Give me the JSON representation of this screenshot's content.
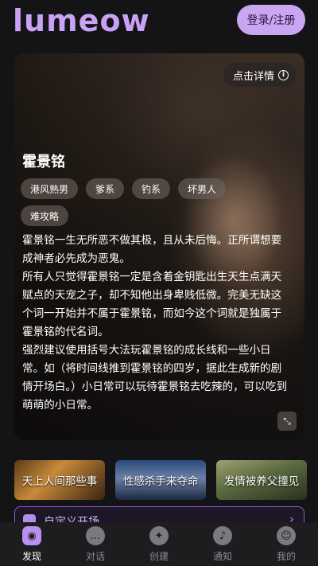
{
  "header": {
    "logo": "lumeow",
    "login_label": "登录/注册"
  },
  "card": {
    "detail_label": "点击详情",
    "name": "霍景铭",
    "tags": [
      "港风熟男",
      "爹系",
      "钓系",
      "坏男人",
      "难攻略"
    ],
    "description": [
      "霍景铭一生无所恶不做其极，且从未后悔。正所谓想要成神者必先成为恶鬼。",
      "所有人只觉得霍景铭一定是含着金钥匙出生天生点满天赋点的天宠之子，却不知他出身卑贱低微。完美无缺这个词一开始并不属于霍景铭，而如今这个词就是独属于霍景铭的代名词。",
      "强烈建议使用括号大法玩霍景铭的成长线和一些小日常。如（将时间线推到霍景铭的四岁，据此生成新的剧情开场白。）小日常可以玩待霍景铭去吃辣的，可以吃到萌萌的小日常。"
    ]
  },
  "scenes": [
    "天上人间那些事",
    "性感杀手来夺命",
    "发情被养父撞见"
  ],
  "custom_opening": {
    "label": "自定义开场"
  },
  "tabbar": {
    "items": [
      {
        "label": "发现",
        "icon": "discover-icon",
        "active": true
      },
      {
        "label": "对话",
        "icon": "chat-icon",
        "active": false
      },
      {
        "label": "创建",
        "icon": "create-icon",
        "active": false
      },
      {
        "label": "通知",
        "icon": "bell-icon",
        "active": false
      },
      {
        "label": "我的",
        "icon": "profile-icon",
        "active": false
      }
    ]
  },
  "colors": {
    "brand": "#c9a2f5",
    "background": "#141416",
    "accent_border": "#8a5ed0"
  }
}
